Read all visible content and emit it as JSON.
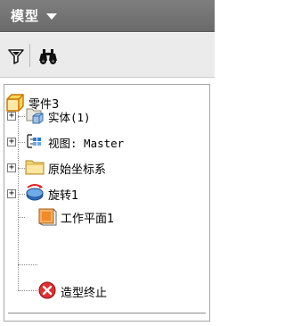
{
  "panel": {
    "title": "模型"
  },
  "toolbar": {
    "filter_icon": "filter-funnel-icon",
    "find_icon": "binoculars-find-icon"
  },
  "tree": {
    "root": {
      "label": "零件3",
      "icon": "part-cube-icon"
    },
    "items": [
      {
        "label": "实体(1)",
        "icon": "solid-bodies-folder-icon",
        "expander": "+"
      },
      {
        "label": "视图: Master",
        "icon": "view-representation-icon",
        "expander": "+"
      },
      {
        "label": "原始坐标系",
        "icon": "folder-icon",
        "expander": "+"
      },
      {
        "label": "旋转1",
        "icon": "revolve-feature-icon",
        "expander": "+"
      },
      {
        "label": "工作平面1",
        "icon": "work-plane-icon",
        "expander": ""
      },
      {
        "label": "造型终止",
        "icon": "end-of-part-icon",
        "expander": ""
      }
    ]
  }
}
